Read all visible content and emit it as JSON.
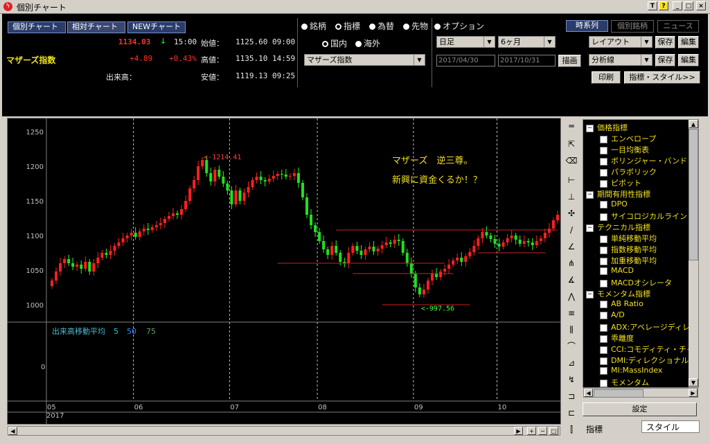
{
  "window": {
    "title": "個別チャート",
    "controls": [
      "T",
      "?",
      "_",
      "□",
      "×"
    ]
  },
  "nav_buttons": [
    "個別チャート",
    "相対チャート",
    "NEWチャート"
  ],
  "quote": {
    "name": "マザーズ指数",
    "price": "1134.03",
    "arrow": "↓",
    "time": "15:00",
    "change": "+4.89",
    "change_pct": "+0.43%",
    "open_label": "始値：",
    "open": "1125.60 09:00",
    "high_label": "高値：",
    "high": "1135.10 14:59",
    "low_label": "安値：",
    "low": "1119.13 09:25",
    "volume_label": "出来高："
  },
  "type_radios": [
    "銘柄",
    "指標",
    "為替",
    "先物",
    "オプション"
  ],
  "type_selected": "指標",
  "region_radios": [
    "国内",
    "海外"
  ],
  "region_selected": "国内",
  "index_select": "マザーズ指数",
  "period": {
    "interval": "日足",
    "range": "6ヶ月",
    "from": "2017/04/30",
    "to": "2017/10/31",
    "draw_button": "描画"
  },
  "right_buttons": {
    "timeseries": "時系列",
    "peer": "個別銘柄",
    "news": "ニュース",
    "layout": "レイアウト",
    "save": "保存",
    "edit": "編集",
    "analysis": "分析線",
    "print": "印刷",
    "indicator_style": "指標・スタイル>>"
  },
  "tree": [
    {
      "label": "価格指標",
      "group": true
    },
    {
      "label": "エンベロープ"
    },
    {
      "label": "一目均衡表"
    },
    {
      "label": "ボリンジャー・バンド"
    },
    {
      "label": "パラボリック"
    },
    {
      "label": "ピボット"
    },
    {
      "label": "期間有用性指標",
      "group": true
    },
    {
      "label": "DPO"
    },
    {
      "label": "サイコロジカルライン"
    },
    {
      "label": "テクニカル指標",
      "group": true
    },
    {
      "label": "単純移動平均"
    },
    {
      "label": "指数移動平均"
    },
    {
      "label": "加重移動平均"
    },
    {
      "label": "MACD"
    },
    {
      "label": "MACDオシレータ"
    },
    {
      "label": "モメンタム指標",
      "group": true
    },
    {
      "label": "AB Ratio"
    },
    {
      "label": "A/D"
    },
    {
      "label": "ADX:アベレージディレ"
    },
    {
      "label": "乖離度"
    },
    {
      "label": "CCI:コモディティ・チャ"
    },
    {
      "label": "DMI:ディレクショナル"
    },
    {
      "label": "MI:MassIndex"
    },
    {
      "label": "モメンタム"
    }
  ],
  "settings_button": "設定",
  "bottom_tabs": [
    "指標",
    "スタイル"
  ],
  "annotation": {
    "line1": "マザーズ　逆三尊。",
    "line2": "新興に資金くるか！？"
  },
  "volume_panel": {
    "label": "出来高移動平均",
    "p1": "5",
    "p2": "50",
    "p3": "75",
    "zero": "0"
  },
  "chart_data": {
    "type": "candlestick",
    "yticks": [
      "1250",
      "1200",
      "1150",
      "1100",
      "1050",
      "1000"
    ],
    "ylim": [
      975,
      1265
    ],
    "months": [
      "05",
      "06",
      "07",
      "08",
      "09",
      "10"
    ],
    "year": "2017",
    "high_label": "<-1214.41",
    "low_label": "<-997.56",
    "closes": [
      1035,
      1048,
      1060,
      1066,
      1060,
      1055,
      1058,
      1052,
      1062,
      1048,
      1060,
      1068,
      1075,
      1072,
      1078,
      1085,
      1090,
      1096,
      1100,
      1104,
      1098,
      1106,
      1110,
      1108,
      1112,
      1115,
      1118,
      1124,
      1128,
      1132,
      1130,
      1138,
      1150,
      1168,
      1180,
      1200,
      1209,
      1190,
      1178,
      1195,
      1185,
      1175,
      1165,
      1145,
      1165,
      1150,
      1162,
      1170,
      1180,
      1185,
      1180,
      1178,
      1182,
      1186,
      1189,
      1188,
      1185,
      1186,
      1190,
      1176,
      1155,
      1130,
      1115,
      1105,
      1092,
      1080,
      1072,
      1085,
      1075,
      1062,
      1060,
      1075,
      1085,
      1078,
      1072,
      1080,
      1084,
      1077,
      1081,
      1086,
      1090,
      1088,
      1094,
      1092,
      1075,
      1060,
      1045,
      1025,
      1015,
      1022,
      1035,
      1045,
      1040,
      1048,
      1052,
      1058,
      1064,
      1068,
      1062,
      1070,
      1076,
      1085,
      1096,
      1105,
      1100,
      1095,
      1088,
      1084,
      1090,
      1096,
      1100,
      1094,
      1088,
      1092,
      1090,
      1086,
      1092,
      1096,
      1104,
      1110,
      1122,
      1130
    ]
  }
}
